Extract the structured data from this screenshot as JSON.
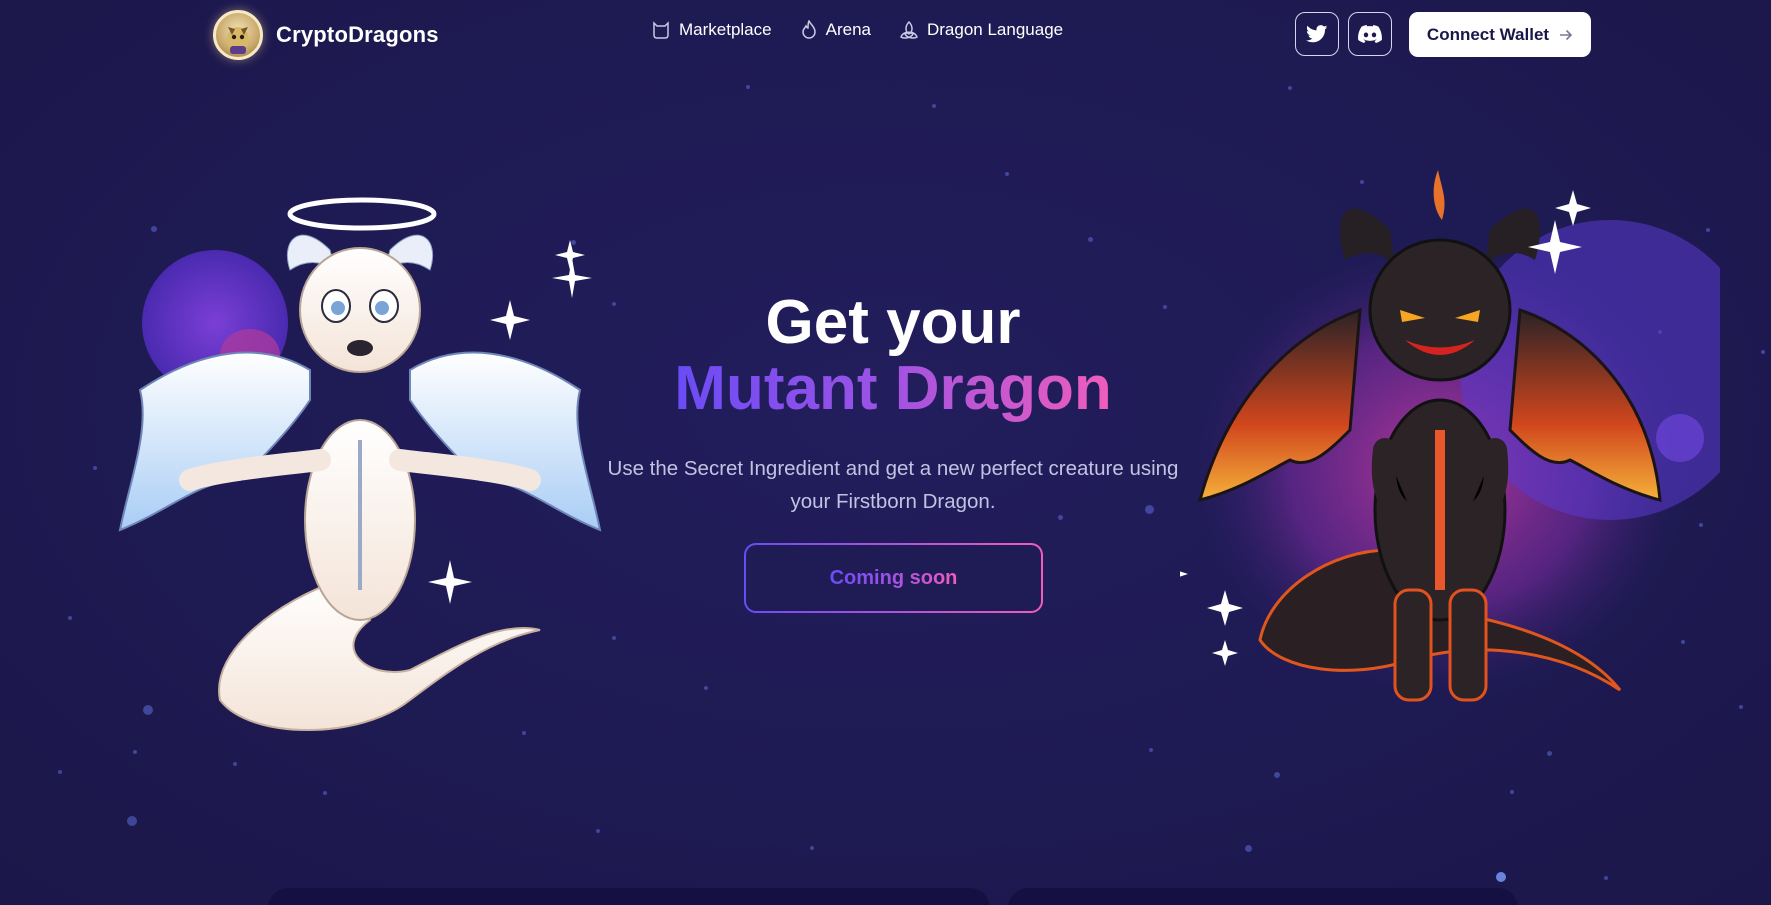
{
  "brand": {
    "name": "CryptoDragons",
    "logo_icon": "dragon-avatar-icon"
  },
  "nav": {
    "items": [
      {
        "label": "Marketplace",
        "icon": "cat-bag-icon"
      },
      {
        "label": "Arena",
        "icon": "flame-icon"
      },
      {
        "label": "Dragon Language",
        "icon": "triquetra-icon"
      }
    ]
  },
  "header": {
    "twitter_icon": "twitter-icon",
    "discord_icon": "discord-icon",
    "connect_wallet_label": "Connect Wallet",
    "connect_wallet_icon": "arrow-right-icon"
  },
  "hero": {
    "title_line1": "Get your",
    "title_line2": "Mutant Dragon",
    "subtitle": "Use the Secret Ingredient and get a new perfect creature using your Firstborn Dragon.",
    "cta_label": "Coming soon"
  },
  "colors": {
    "background": "#1f1b55",
    "gradient_start": "#6a4cf5",
    "gradient_end": "#f05dbb",
    "button_bg": "#ffffff",
    "text_muted": "#c3c2e2"
  }
}
